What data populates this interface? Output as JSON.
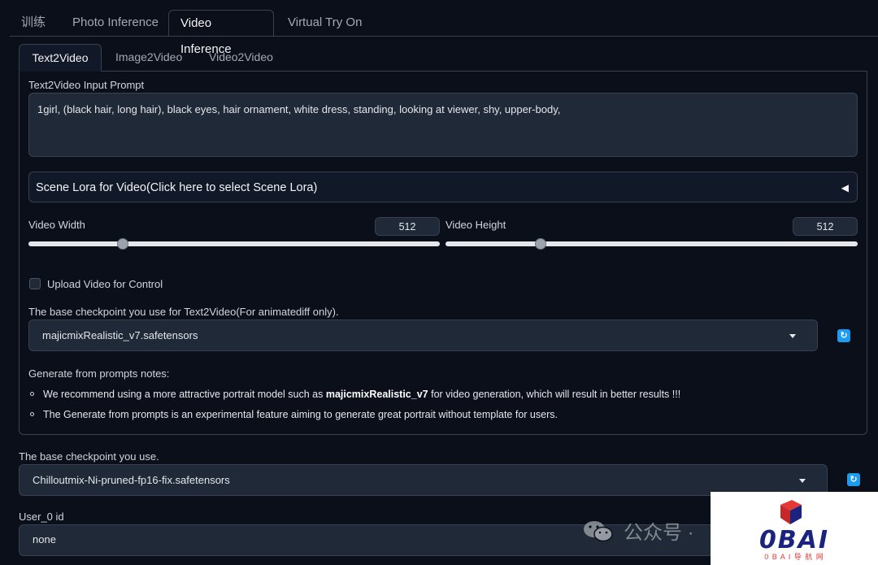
{
  "top_tabs": [
    {
      "label": "训练"
    },
    {
      "label": "Photo Inference"
    },
    {
      "label": "Video Inference"
    },
    {
      "label": "Virtual Try On"
    }
  ],
  "sub_tabs": [
    {
      "label": "Text2Video"
    },
    {
      "label": "Image2Video"
    },
    {
      "label": "Video2Video"
    }
  ],
  "prompt": {
    "label": "Text2Video Input Prompt",
    "value": "1girl, (black hair, long hair), black eyes, hair ornament, white dress, standing, looking at viewer, shy, upper-body,"
  },
  "scene_lora": {
    "label": "Scene Lora for Video(Click here to select Scene Lora)",
    "toggle_icon": "◀"
  },
  "width": {
    "label": "Video Width",
    "value": "512",
    "fraction": 0.23
  },
  "height": {
    "label": "Video Height",
    "value": "512",
    "fraction": 0.23
  },
  "upload_control": {
    "label": "Upload Video for Control",
    "checked": false
  },
  "t2v_checkpoint": {
    "label": "The base checkpoint you use for Text2Video(For animatediff only).",
    "value": "majicmixRealistic_v7.safetensors"
  },
  "notes": {
    "title": "Generate from prompts notes:",
    "item1_pre": "We recommend using a more attractive portrait model such as ",
    "item1_bold": "majicmixRealistic_v7",
    "item1_post": " for video generation, which will result in better results !!!",
    "item2": "The Generate from prompts is an experimental feature aiming to generate great portrait without template for users."
  },
  "base_checkpoint": {
    "label": "The base checkpoint you use.",
    "value": "Chilloutmix-Ni-pruned-fp16-fix.safetensors"
  },
  "user_id": {
    "label": "User_0 id",
    "value": "none"
  },
  "watermark": {
    "text": "公众号 ·"
  },
  "logo": {
    "text": "0BAI",
    "sub": "0 B A I 导 航 网"
  },
  "colors": {
    "accent": "#1d9bf0",
    "background": "#0b0f19",
    "input": "#1f2937",
    "logo_red": "#e53935",
    "logo_navy": "#1a237e"
  }
}
